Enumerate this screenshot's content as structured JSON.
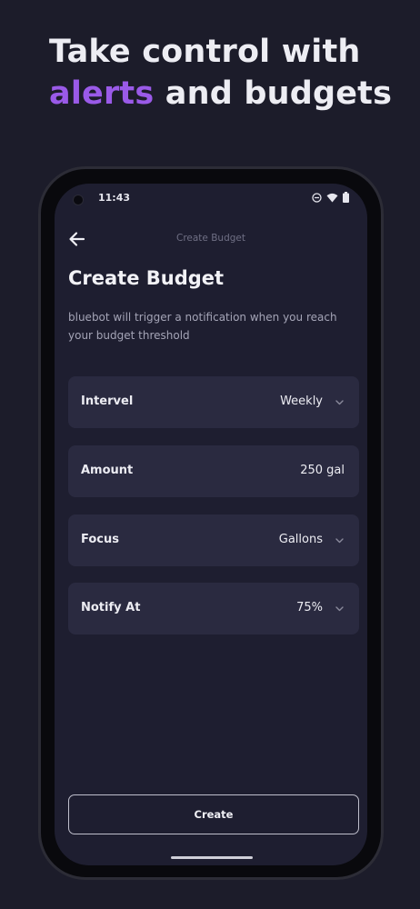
{
  "promo": {
    "line1": "Take control with",
    "line2_accent": "alerts",
    "line2_rest": " and budgets"
  },
  "status_bar": {
    "time": "11:43",
    "icons": [
      "do-not-disturb-icon",
      "wifi-icon",
      "battery-icon"
    ]
  },
  "nav": {
    "back_icon": "arrow-left-icon",
    "title": "Create Budget"
  },
  "header": {
    "title": "Create Budget",
    "subtitle": "bluebot will trigger a notification when you reach your budget threshold"
  },
  "form": {
    "fields": [
      {
        "label": "Intervel",
        "value": "Weekly",
        "dropdown": true
      },
      {
        "label": "Amount",
        "value": "250 gal",
        "dropdown": false
      },
      {
        "label": "Focus",
        "value": "Gallons",
        "dropdown": true
      },
      {
        "label": "Notify At",
        "value": "75%",
        "dropdown": true
      }
    ]
  },
  "actions": {
    "create_label": "Create"
  },
  "colors": {
    "background": "#1c1c2a",
    "screen": "#1e1e30",
    "field": "#2a2a40",
    "accent": "#9a5ae8"
  }
}
